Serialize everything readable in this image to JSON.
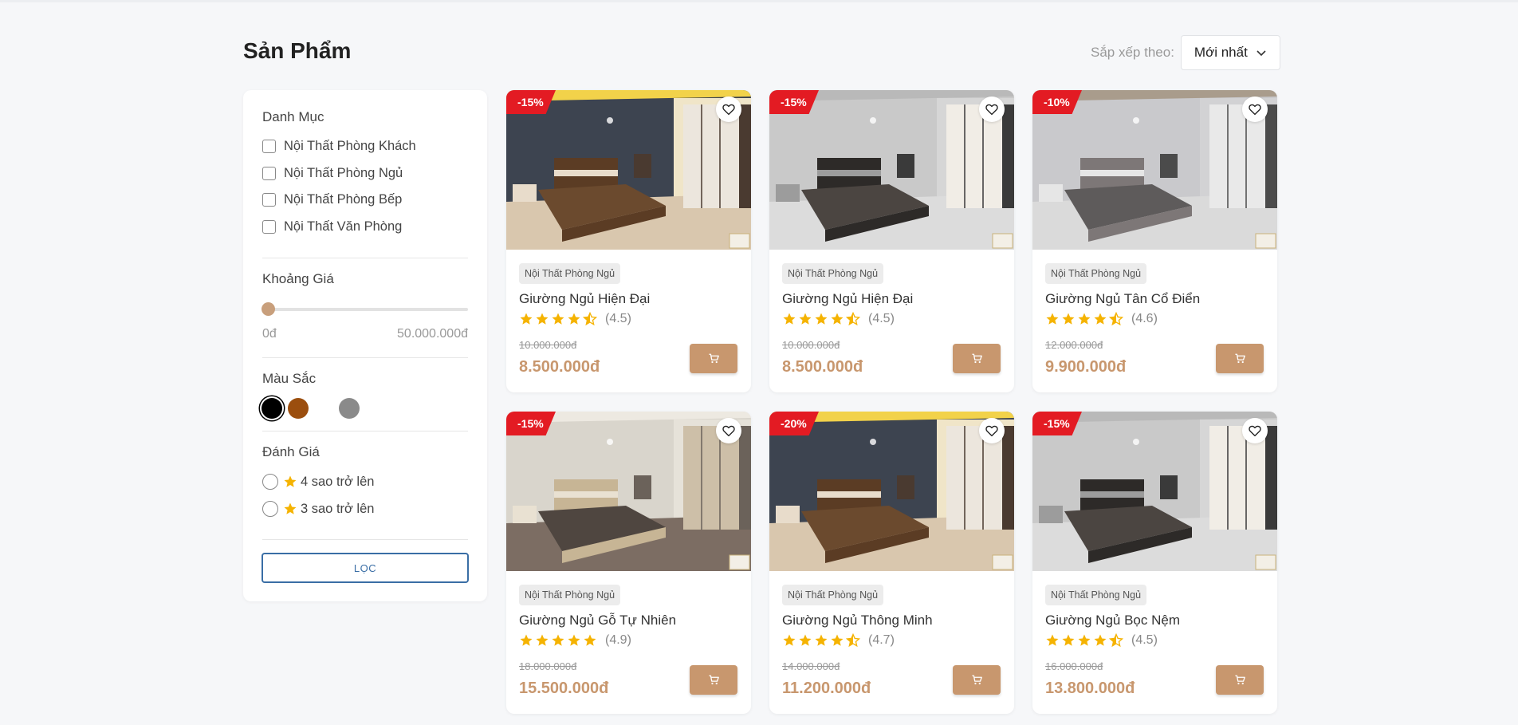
{
  "header": {
    "title": "Sản Phẩm",
    "sort_label": "Sắp xếp theo:",
    "sort_value": "Mới nhất"
  },
  "sidebar": {
    "category_title": "Danh Mục",
    "categories": [
      "Nội Thất Phòng Khách",
      "Nội Thất Phòng Ngủ",
      "Nội Thất Phòng Bếp",
      "Nội Thất Văn Phòng"
    ],
    "price_title": "Khoảng Giá",
    "price_min": "0đ",
    "price_max": "50.000.000đ",
    "price_level": 0,
    "color_title": "Màu Sắc",
    "colors": [
      "#000000",
      "#9b4e0e",
      "#ffffff",
      "#8a8a8a"
    ],
    "rating_title": "Đánh Giá",
    "rating_options": [
      "4 sao trở lên",
      "3 sao trở lên"
    ],
    "filter_button": "LỌC"
  },
  "products": [
    {
      "discount": "-15%",
      "category": "Nội Thất Phòng Ngủ",
      "name": "Giường Ngủ Hiện Đại",
      "rating": 4.5,
      "rating_text": "(4.5)",
      "old_price": "10.000.000đ",
      "price": "8.500.000đ"
    },
    {
      "discount": "-15%",
      "category": "Nội Thất Phòng Ngủ",
      "name": "Giường Ngủ Hiện Đại",
      "rating": 4.5,
      "rating_text": "(4.5)",
      "old_price": "10.000.000đ",
      "price": "8.500.000đ"
    },
    {
      "discount": "-10%",
      "category": "Nội Thất Phòng Ngủ",
      "name": "Giường Ngủ Tân Cổ Điển",
      "rating": 4.6,
      "rating_text": "(4.6)",
      "old_price": "12.000.000đ",
      "price": "9.900.000đ"
    },
    {
      "discount": "-15%",
      "category": "Nội Thất Phòng Ngủ",
      "name": "Giường Ngủ Gỗ Tự Nhiên",
      "rating": 4.9,
      "rating_text": "(4.9)",
      "old_price": "18.000.000đ",
      "price": "15.500.000đ"
    },
    {
      "discount": "-20%",
      "category": "Nội Thất Phòng Ngủ",
      "name": "Giường Ngủ Thông Minh",
      "rating": 4.7,
      "rating_text": "(4.7)",
      "old_price": "14.000.000đ",
      "price": "11.200.000đ"
    },
    {
      "discount": "-15%",
      "category": "Nội Thất Phòng Ngủ",
      "name": "Giường Ngủ Bọc Nệm",
      "rating": 4.5,
      "rating_text": "(4.5)",
      "old_price": "16.000.000đ",
      "price": "13.800.000đ"
    }
  ],
  "colors": {
    "accent": "#c8976e",
    "discount_badge": "#e31b23",
    "star": "#f5b301",
    "filter_button": "#3a6ea5"
  },
  "icons": {
    "sort": "chevron-down-icon",
    "wishlist": "heart-icon",
    "cart": "cart-icon",
    "rating": "star-icon"
  }
}
